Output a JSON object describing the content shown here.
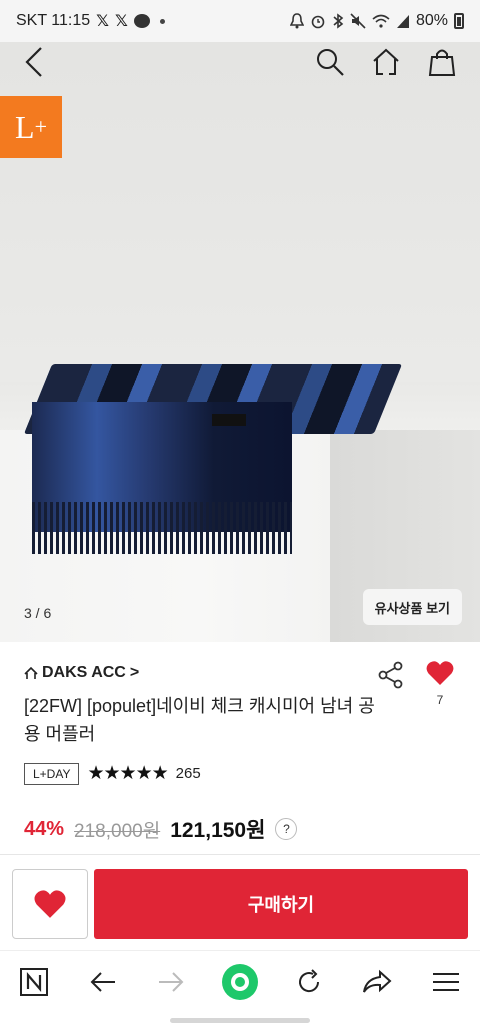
{
  "status_bar": {
    "carrier_time": "SKT 11:15",
    "x_icon_1": "𝕏",
    "x_icon_2": "𝕏",
    "battery": "80%"
  },
  "hero": {
    "badge": "L",
    "badge_sup": "+",
    "page_counter": "3 / 6",
    "similar_button": "유사상품 보기"
  },
  "product": {
    "brand": "DAKS ACC",
    "brand_chevron": ">",
    "like_count": "7",
    "name": "[22FW] [populet]네이비 체크 캐시미어 남녀 공용 머플러",
    "delivery_badge": "L+DAY",
    "stars": "★★★★★",
    "review_count": "265",
    "discount": "44%",
    "original_price": "218,000원",
    "final_price": "121,150원",
    "help": "?"
  },
  "buy_bar": {
    "buy_label": "구매하기"
  },
  "colors": {
    "accent_red": "#e02536",
    "l_plus_orange": "#f37a1f",
    "browser_green": "#1ec86a"
  }
}
